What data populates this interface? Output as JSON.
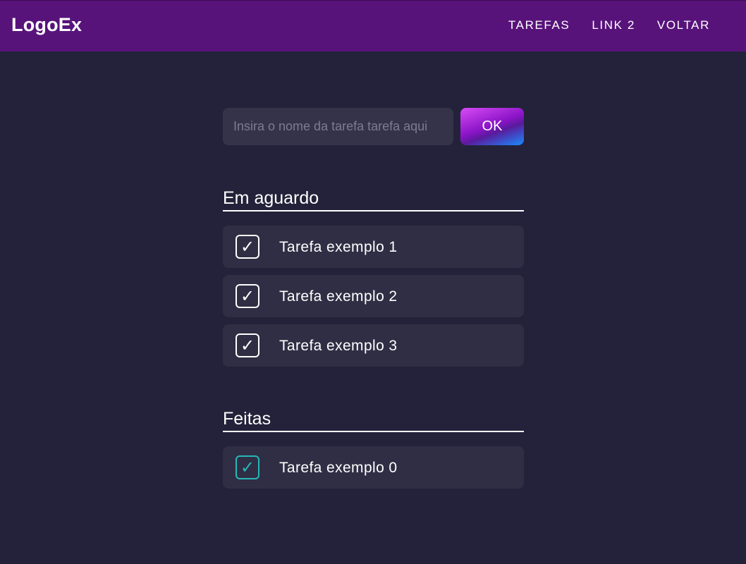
{
  "navbar": {
    "logo": "LogoEx",
    "links": [
      {
        "label": "TAREFAS"
      },
      {
        "label": "LINK 2"
      },
      {
        "label": "VOLTAR"
      }
    ]
  },
  "form": {
    "input_placeholder": "Insira o nome da tarefa tarefa aqui",
    "input_value": "",
    "button_label": "OK"
  },
  "pending": {
    "title": "Em aguardo",
    "tasks": [
      {
        "label": "Tarefa exemplo 1",
        "icon": "check-icon"
      },
      {
        "label": "Tarefa exemplo 2",
        "icon": "check-icon"
      },
      {
        "label": "Tarefa exemplo 3",
        "icon": "check-icon"
      }
    ]
  },
  "done": {
    "title": "Feitas",
    "tasks": [
      {
        "label": "Tarefa exemplo 0",
        "icon": "check-icon"
      }
    ]
  },
  "colors": {
    "background": "#23223a",
    "navbar": "#58137b",
    "card": "#302e44",
    "input": "#353349",
    "done_accent": "#26b8b8"
  }
}
